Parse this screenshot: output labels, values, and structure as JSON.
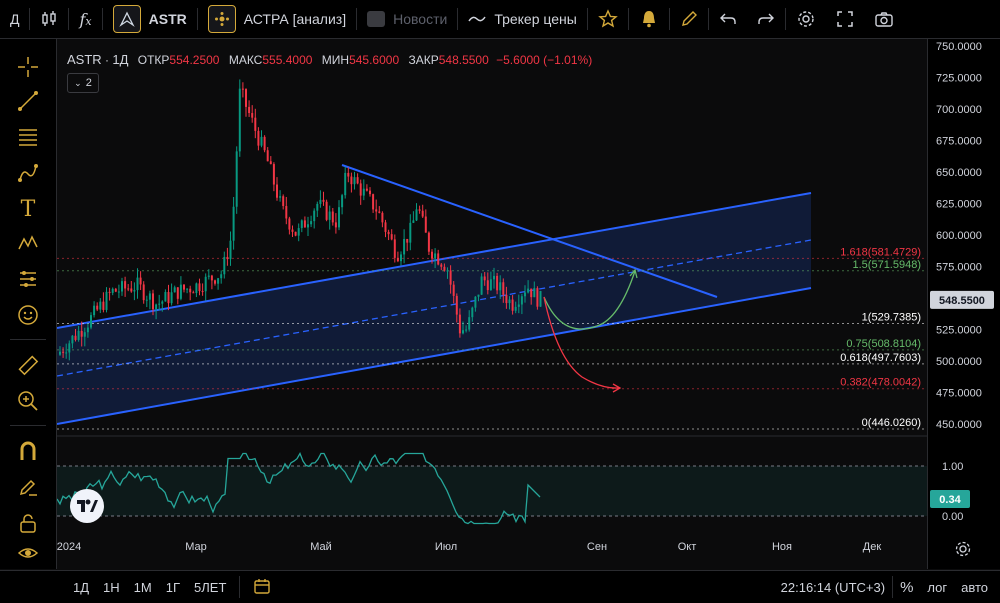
{
  "topbar": {
    "interval": "Д",
    "symbol": "ASTR",
    "script_name": "АСТРА [анализ]",
    "news": "Новости",
    "tracker": "Трекер цены"
  },
  "legend": {
    "symbol": "ASTR",
    "interval": "1Д",
    "open_label": "ОТКР",
    "open": "554.2500",
    "high_label": "МАКС",
    "high": "555.4000",
    "low_label": "МИН",
    "low": "545.6000",
    "close_label": "ЗАКР",
    "close": "548.5500",
    "change": "−5.6000 (−1.01%)",
    "indicators_count": "2"
  },
  "price_axis": {
    "ticks": [
      "750.0000",
      "725.0000",
      "700.0000",
      "675.0000",
      "650.0000",
      "625.0000",
      "600.0000",
      "575.0000",
      "550.0000",
      "525.0000",
      "500.0000",
      "475.0000",
      "450.0000"
    ],
    "current_price": "548.5500",
    "osc_ticks": [
      "1.00",
      "0.00"
    ],
    "osc_value": "0.34"
  },
  "fib_levels": [
    {
      "label": "1.618(581.4729)",
      "value": 581.4729,
      "color": "#f23645"
    },
    {
      "label": "1.5(571.5948)",
      "value": 571.5948,
      "color": "#66bb6a"
    },
    {
      "label": "1(529.7385)",
      "value": 529.7385,
      "color": "#ffffff"
    },
    {
      "label": "0.75(508.8104)",
      "value": 508.8104,
      "color": "#66bb6a"
    },
    {
      "label": "0.618(497.7603)",
      "value": 497.7603,
      "color": "#ffffff"
    },
    {
      "label": "0.382(478.0042)",
      "value": 478.0042,
      "color": "#f23645"
    },
    {
      "label": "0(446.0260)",
      "value": 446.026,
      "color": "#ffffff"
    }
  ],
  "time_axis": [
    "2024",
    "Мар",
    "Май",
    "Июл",
    "Сен",
    "Окт",
    "Ноя",
    "Дек"
  ],
  "bottombar": {
    "ranges": [
      "1Д",
      "1Н",
      "1М",
      "1Г",
      "5ЛЕТ"
    ],
    "clock": "22:16:14 (UTC+3)",
    "percent": "%",
    "log": "лог",
    "auto": "авто"
  },
  "colors": {
    "accent": "#d4a93a",
    "up": "#089981",
    "down": "#f23645",
    "channel": "#2962ff",
    "oscillator": "#26a69a"
  }
}
